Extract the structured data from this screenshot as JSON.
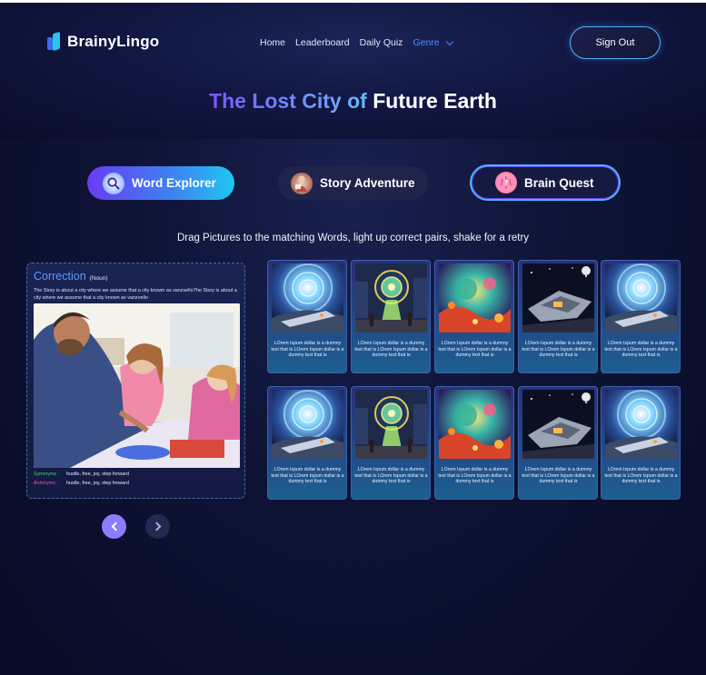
{
  "header": {
    "logo_text": "BrainyLingo",
    "nav": [
      "Home",
      "Leaderboard",
      "Daily Quiz"
    ],
    "genre_label": "Genre",
    "sign_out": "Sign Out"
  },
  "title": {
    "part1": "The Lost City of",
    "part2": "Future Earth"
  },
  "modes": [
    {
      "label": "Word Explorer",
      "icon": "magnifier-icon"
    },
    {
      "label": "Story Adventure",
      "icon": "storyteller-icon"
    },
    {
      "label": "Brain Quest",
      "icon": "brain-icon"
    }
  ],
  "instruction": "Drag Pictures to the matching Words, light up correct pairs, shake for a retry",
  "word_card": {
    "title": "Correction",
    "pos": "(Noun)",
    "description": "The Story is about a city where we assume that a city known as vanzvelloThe Story is about a city where we assume that a city known as vanzvello",
    "synonyms_label": "Synonyms :",
    "synonyms": "hustle, free, joy, step forward",
    "antonyms_label": "Antonyms :",
    "antonyms": "hustle, free, joy, step forward"
  },
  "pictures": [
    {
      "scene": "space-tunnel",
      "caption": "LOrem Ispum dollar is a dummy text that is LOrem Ispum dollar is a dummy text that is"
    },
    {
      "scene": "portal-city",
      "caption": "LOrem Ispum dollar is a dummy text that is LOrem Ispum dollar is a dummy text that is"
    },
    {
      "scene": "nebula",
      "caption": "LOrem Ispum dollar is a dummy text that is LOrem Ispum dollar is a dummy text that is"
    },
    {
      "scene": "spaceship",
      "caption": "LOrem Ispum dollar is a dummy text that is LOrem Ispum dollar is a dummy text that is"
    },
    {
      "scene": "space-tunnel",
      "caption": "LOrem Ispum dollar is a dummy text that is LOrem Ispum dollar is a dummy text that is"
    },
    {
      "scene": "space-tunnel",
      "caption": "LOrem Ispum dollar is a dummy text that is LOrem Ispum dollar is a dummy text that is"
    },
    {
      "scene": "portal-city",
      "caption": "LOrem Ispum dollar is a dummy text that is LOrem Ispum dollar is a dummy text that is"
    },
    {
      "scene": "nebula",
      "caption": "LOrem Ispum dollar is a dummy text that is LOrem Ispum dollar is a dummy text that is"
    },
    {
      "scene": "spaceship",
      "caption": "LOrem Ispum dollar is a dummy text that is LOrem Ispum dollar is a dummy text that is"
    },
    {
      "scene": "space-tunnel",
      "caption": "LOrem Ispum dollar is a dummy text that is LOrem Ispum dollar is a dummy text that is"
    }
  ],
  "colors": {
    "accent_blue": "#4f8dff",
    "accent_purple": "#8e7cff",
    "synonym": "#49d36b",
    "antonym": "#ff4f9a"
  }
}
